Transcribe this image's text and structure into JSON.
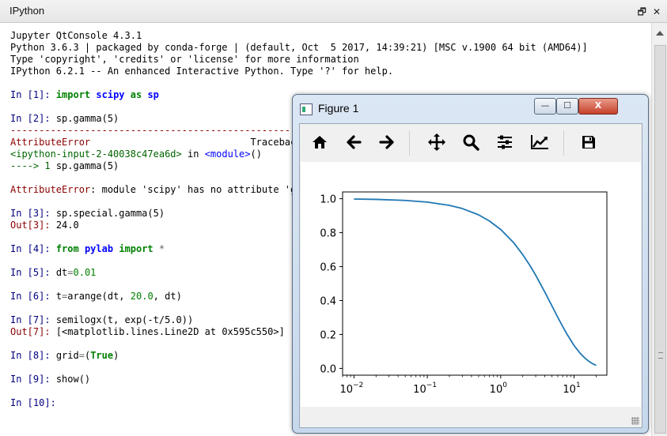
{
  "dock": {
    "title": "IPython",
    "float_btn": "🗗",
    "close_btn": "✕"
  },
  "console": {
    "banner": [
      "Jupyter QtConsole 4.3.1",
      "Python 3.6.3 | packaged by conda-forge | (default, Oct  5 2017, 14:39:21) [MSC v.1900 64 bit (AMD64)]",
      "Type 'copyright', 'credits' or 'license' for more information",
      "IPython 6.2.1 -- An enhanced Interactive Python. Type '?' for help."
    ],
    "p1": {
      "prompt": "In [1]:",
      "k1": "import",
      "m": "scipy",
      "k2": "as",
      "alias": "sp"
    },
    "p2": {
      "prompt": "In [2]:",
      "code": "sp.gamma(5)"
    },
    "tb_rule": "---------------------------------------------------------------------------",
    "tb": {
      "err_name": "AttributeError",
      "traceback": "Traceback",
      "file": "<ipython-input-2-40038c47ea6d>",
      "in_word": "in",
      "module": "<module>",
      "parens": "()",
      "arrow": "----> 1",
      "arrow_code": "sp.gamma(5)",
      "msg_name": "AttributeError",
      "msg": ": module 'scipy' has no attribute 'ga"
    },
    "p3": {
      "prompt": "In [3]:",
      "code": "sp.special.gamma(5)",
      "out_prompt": "Out[3]:",
      "out": "24.0"
    },
    "p4": {
      "prompt": "In [4]:",
      "k1": "from",
      "m": "pylab",
      "k2": "import",
      "star": "*"
    },
    "p5": {
      "prompt": "In [5]:",
      "pre": "dt",
      "eq": "=",
      "val": "0.01"
    },
    "p6": {
      "prompt": "In [6]:",
      "pre": "t",
      "eq": "=",
      "fn": "arange(dt, ",
      "n": "20.0",
      "post": ", dt)"
    },
    "p7": {
      "prompt": "In [7]:",
      "code": "semilogx(t, exp(-t/5.0))",
      "out_prompt": "Out[7]:",
      "out": "[<matplotlib.lines.Line2D at 0x595c550>]"
    },
    "p8": {
      "prompt": "In [8]:",
      "pre": "grid",
      "eq": "=",
      "lp": "(",
      "val": "True",
      "rp": ")"
    },
    "p9": {
      "prompt": "In [9]:",
      "code": "show()"
    },
    "p10": {
      "prompt": "In [10]:"
    }
  },
  "figure": {
    "title": "Figure 1",
    "min_btn": "—",
    "max_btn": "☐",
    "close_btn": "X",
    "toolbar": [
      "home-icon",
      "back-icon",
      "forward-icon",
      "pan-icon",
      "zoom-icon",
      "configure-subplots-icon",
      "edit-axis-icon",
      "save-icon"
    ]
  },
  "chart_data": {
    "type": "line",
    "x_scale": "log",
    "xlim": [
      0.007,
      28
    ],
    "ylim": [
      -0.04,
      1.04
    ],
    "grid": false,
    "yticks": [
      0.0,
      0.2,
      0.4,
      0.6,
      0.8,
      1.0
    ],
    "ytick_labels": [
      "0.0",
      "0.2",
      "0.4",
      "0.6",
      "0.8",
      "1.0"
    ],
    "xticks": [
      0.01,
      0.1,
      1,
      10
    ],
    "xtick_labels": [
      {
        "base": "10",
        "exp": "−2"
      },
      {
        "base": "10",
        "exp": "−1"
      },
      {
        "base": "10",
        "exp": "0"
      },
      {
        "base": "10",
        "exp": "1"
      }
    ],
    "series": [
      {
        "color": "#1f77b4",
        "x": [
          0.01,
          0.02,
          0.05,
          0.1,
          0.2,
          0.3,
          0.5,
          0.7,
          1.0,
          1.5,
          2.0,
          2.5,
          3.0,
          4.0,
          5.0,
          6.0,
          7.0,
          8.0,
          10.0,
          12.0,
          14.0,
          16.0,
          18.0,
          19.99
        ],
        "y": [
          0.998,
          0.996,
          0.99,
          0.98,
          0.961,
          0.942,
          0.905,
          0.869,
          0.819,
          0.741,
          0.67,
          0.607,
          0.549,
          0.449,
          0.368,
          0.301,
          0.247,
          0.202,
          0.135,
          0.091,
          0.061,
          0.041,
          0.027,
          0.018
        ]
      }
    ]
  }
}
